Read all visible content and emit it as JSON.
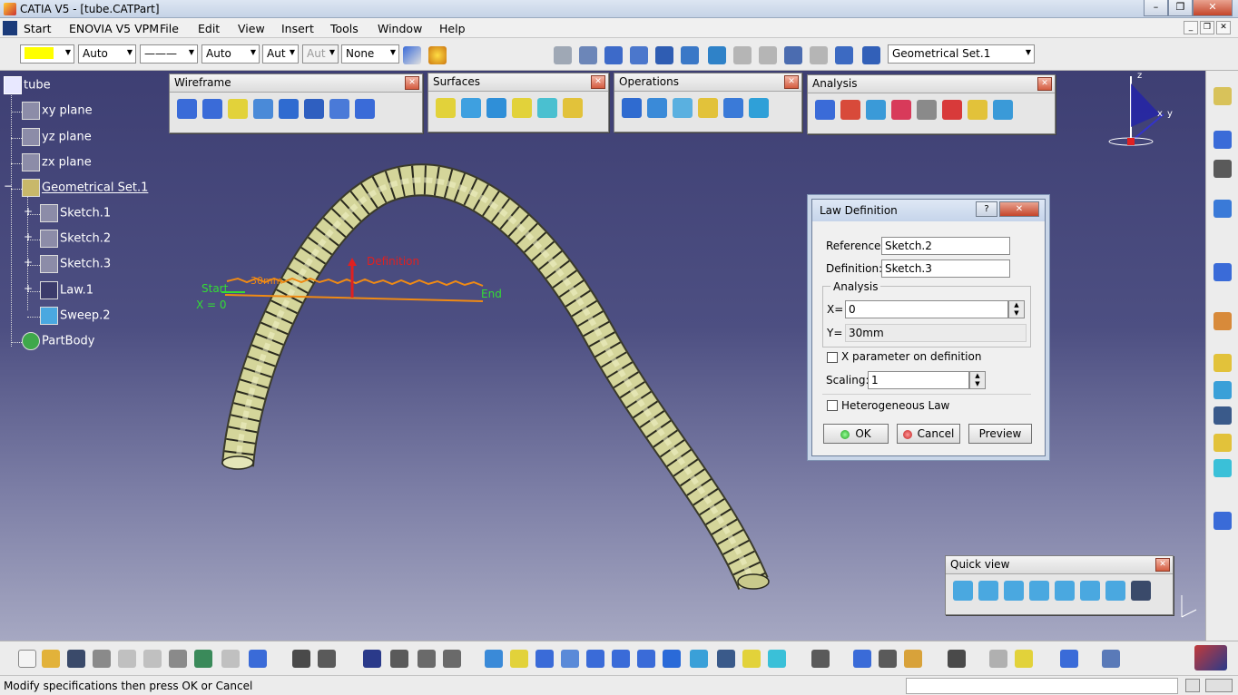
{
  "window": {
    "title": "CATIA V5 - [tube.CATPart]",
    "controls": {
      "minimize": "–",
      "maximize": "❐",
      "close": "✕"
    }
  },
  "menu": {
    "items": [
      "Start",
      "ENOVIA V5 VPM",
      "File",
      "Edit",
      "View",
      "Insert",
      "Tools",
      "Window",
      "Help"
    ],
    "doc_controls": {
      "minimize": "_",
      "restore": "❐",
      "close": "✕"
    }
  },
  "top_toolbar": {
    "color_value": "",
    "line_type": "Auto",
    "line_style": "———",
    "thickness": "Auto",
    "point_type": "Aut",
    "disabled_combo": "Aut",
    "layer": "None",
    "geometrical_set": "Geometrical Set.1"
  },
  "tree": {
    "root": "tube",
    "nodes": [
      {
        "label": "xy plane",
        "icon": "plane-icon"
      },
      {
        "label": "yz plane",
        "icon": "plane-icon"
      },
      {
        "label": "zx plane",
        "icon": "plane-icon"
      },
      {
        "label": "Geometrical Set.1",
        "icon": "geometrical-set-icon"
      },
      {
        "label": "Sketch.1",
        "icon": "sketch-icon"
      },
      {
        "label": "Sketch.2",
        "icon": "sketch-icon"
      },
      {
        "label": "Sketch.3",
        "icon": "sketch-icon"
      },
      {
        "label": "Law.1",
        "icon": "law-icon"
      },
      {
        "label": "Sweep.2",
        "icon": "sweep-icon"
      },
      {
        "label": "PartBody",
        "icon": "partbody-icon"
      }
    ]
  },
  "floating_toolbars": {
    "wireframe": {
      "title": "Wireframe",
      "close": "✕"
    },
    "surfaces": {
      "title": "Surfaces",
      "close": "✕"
    },
    "operations": {
      "title": "Operations",
      "close": "✕"
    },
    "analysis": {
      "title": "Analysis",
      "close": "✕"
    },
    "quick_view": {
      "title": "Quick view",
      "close": "✕"
    }
  },
  "law_annotations": {
    "start": "Start",
    "x_zero": "X = 0",
    "end": "End",
    "definition": "Definition",
    "value": "30mm"
  },
  "compass": {
    "z": "z",
    "x": "x",
    "y": "y"
  },
  "law_dialog": {
    "title": "Law Definition",
    "help": "?",
    "close": "✕",
    "reference_label": "Reference:",
    "reference_value": "Sketch.2",
    "definition_label": "Definition:",
    "definition_value": "Sketch.3",
    "analysis_label": "Analysis",
    "x_label": "X=",
    "x_value": "0",
    "y_label": "Y=",
    "y_value": "30mm",
    "x_param_label": "X parameter on definition",
    "x_param_checked": false,
    "scaling_label": "Scaling:",
    "scaling_value": "1",
    "hetero_label": "Heterogeneous Law",
    "hetero_checked": false,
    "ok": "OK",
    "cancel": "Cancel",
    "preview": "Preview"
  },
  "status": {
    "message": "Modify specifications then press OK or Cancel"
  },
  "colors": {
    "viewport_top": "#3e3f73",
    "viewport_bottom": "#a6a8c2",
    "tube_fill": "#d4d59a",
    "law_curve": "#f08a14",
    "law_start": "#33dd33",
    "definition_red": "#e02020",
    "color_swatch": "#ffff00"
  }
}
